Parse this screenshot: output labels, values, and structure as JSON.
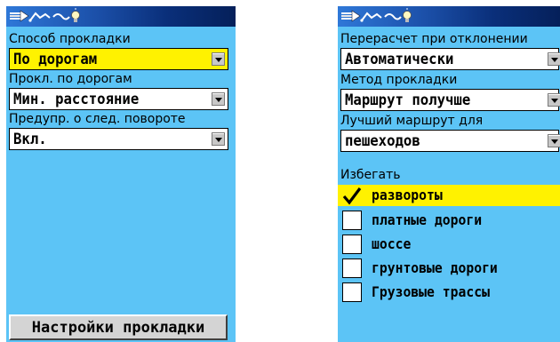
{
  "left_screen": {
    "label_route_method": "Способ прокладки",
    "value_route_method": "По дорогам",
    "label_road_routing": "Прокл. по дорогам",
    "value_road_routing": "Мин. расстояние",
    "label_turn_warning": "Предупр. о след. повороте",
    "value_turn_warning": "Вкл.",
    "settings_button": "Настройки прокладки"
  },
  "right_screen": {
    "label_recalc": "Перерасчет при отклонении",
    "value_recalc": "Автоматически",
    "label_method": "Метод прокладки",
    "value_method": "Маршрут получше",
    "label_best_for": "Лучший маршрут для",
    "value_best_for": "пешеходов",
    "label_avoid": "Избегать",
    "avoid_items": [
      {
        "label": "развороты",
        "checked": true
      },
      {
        "label": "платные дороги",
        "checked": false
      },
      {
        "label": "шоссе",
        "checked": false
      },
      {
        "label": "грунтовые дороги",
        "checked": false
      },
      {
        "label": "Грузовые трассы",
        "checked": false
      }
    ]
  },
  "titlebar_icons": [
    "pointer-icon",
    "route-icon",
    "lightbulb-icon"
  ],
  "colors": {
    "screen_bg": "#5cc4f6",
    "highlight": "#fff200",
    "titlebar": "#1b4fa8"
  }
}
